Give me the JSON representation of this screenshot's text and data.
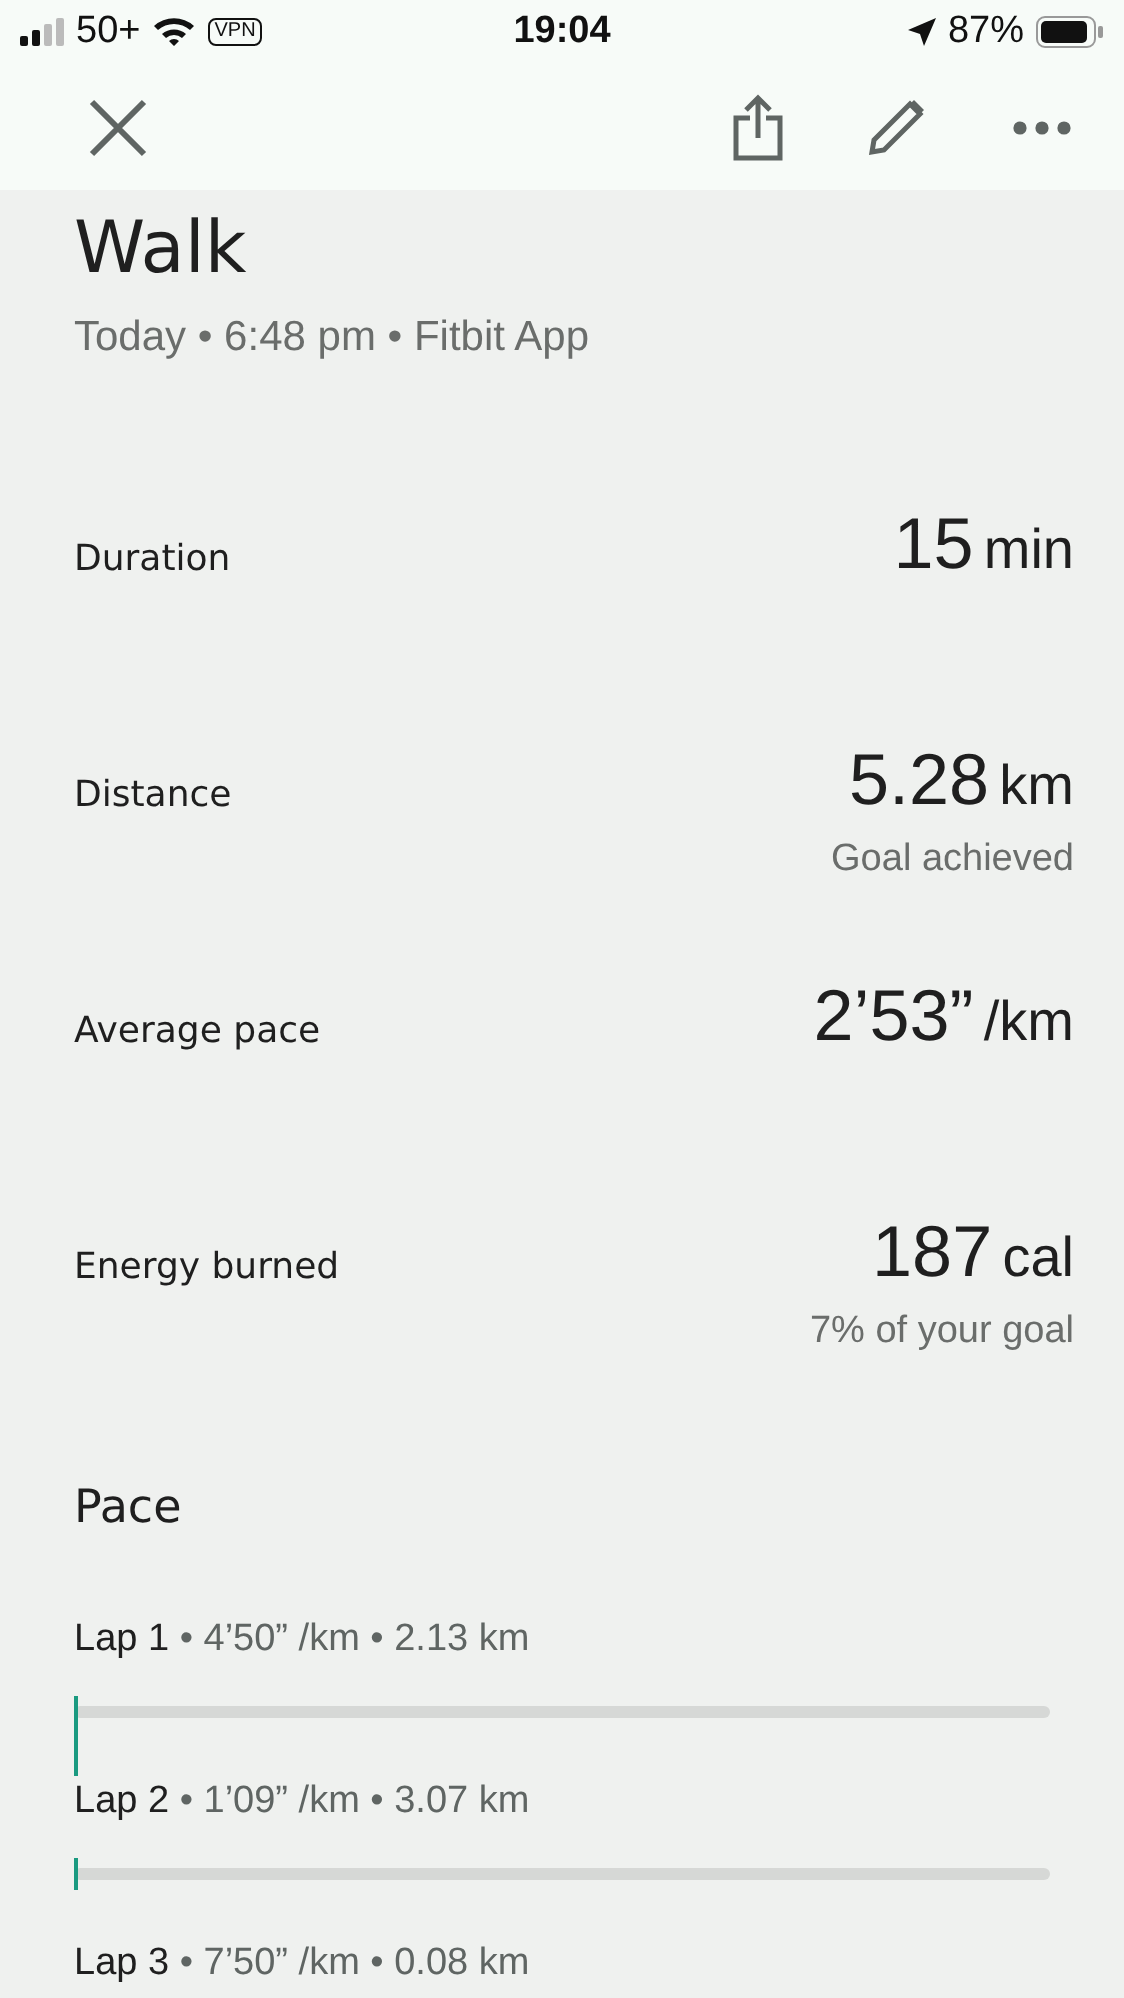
{
  "status_bar": {
    "carrier": "50+",
    "vpn": "VPN",
    "time": "19:04",
    "battery": "87%"
  },
  "toolbar": {
    "buttons": [
      {
        "kind": "close"
      },
      {
        "kind": "share"
      },
      {
        "kind": "edit"
      },
      {
        "kind": "more"
      }
    ]
  },
  "title": "Walk",
  "subtitle": "Today • 6:48 pm • Fitbit App",
  "stats": [
    {
      "label": "Duration",
      "value": "15",
      "unit": "min"
    },
    {
      "label": "Distance",
      "value": "5.28",
      "unit": "km",
      "note": "Goal achieved"
    },
    {
      "label": "Average pace",
      "value": "2’53”",
      "unit": "/km"
    },
    {
      "label": "Energy burned",
      "value": "187",
      "unit": "cal",
      "note": "7% of your goal"
    }
  ],
  "pace": {
    "heading": "Pace",
    "laps": [
      {
        "name": "Lap 1",
        "detail": "• 4’50” /km • 2.13 km",
        "level": 0
      },
      {
        "name": "Lap 2",
        "detail": "• 1’09” /km • 3.07 km",
        "level": 0
      },
      {
        "name": "Lap 3",
        "detail": "• 7’50” /km • 0.08 km"
      }
    ]
  }
}
